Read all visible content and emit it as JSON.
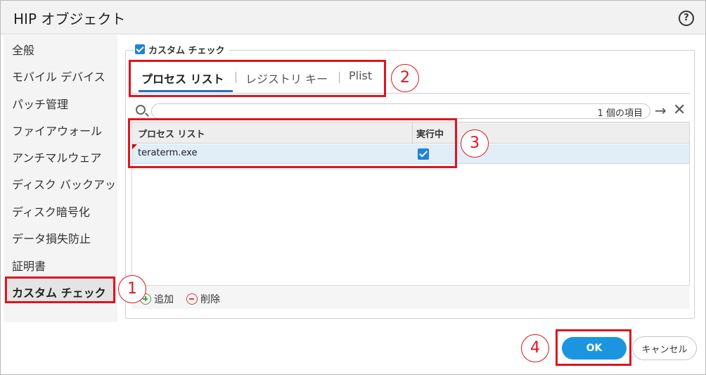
{
  "dialog": {
    "title": "HIP オブジェクト",
    "help_label": "?"
  },
  "sidebar": {
    "items": [
      {
        "label": "全般"
      },
      {
        "label": "モバイル デバイス"
      },
      {
        "label": "パッチ管理"
      },
      {
        "label": "ファイアウォール"
      },
      {
        "label": "アンチマルウェア"
      },
      {
        "label": "ディスク バックアップ"
      },
      {
        "label": "ディスク暗号化"
      },
      {
        "label": "データ損失防止"
      },
      {
        "label": "証明書"
      },
      {
        "label": "カスタム チェック"
      }
    ],
    "active_index": 9
  },
  "section": {
    "checkbox_label": "カスタム チェック",
    "checked": true
  },
  "tabs": [
    {
      "label": "プロセス リスト",
      "active": true
    },
    {
      "label": "レジストリ キー",
      "active": false
    },
    {
      "label": "Plist",
      "active": false
    }
  ],
  "search": {
    "count_text": "1 個の項目",
    "go_symbol": "→",
    "clear_symbol": "✕"
  },
  "table": {
    "columns": [
      "プロセス リスト",
      "実行中"
    ],
    "rows": [
      {
        "process": "teraterm.exe",
        "running": true
      }
    ]
  },
  "actions": {
    "add_label": "追加",
    "delete_label": "削除"
  },
  "buttons": {
    "ok_label": "OK",
    "cancel_label": "キャンセル"
  },
  "annotations": {
    "markers": [
      "1",
      "2",
      "3",
      "4"
    ],
    "color": "#e0141e"
  }
}
